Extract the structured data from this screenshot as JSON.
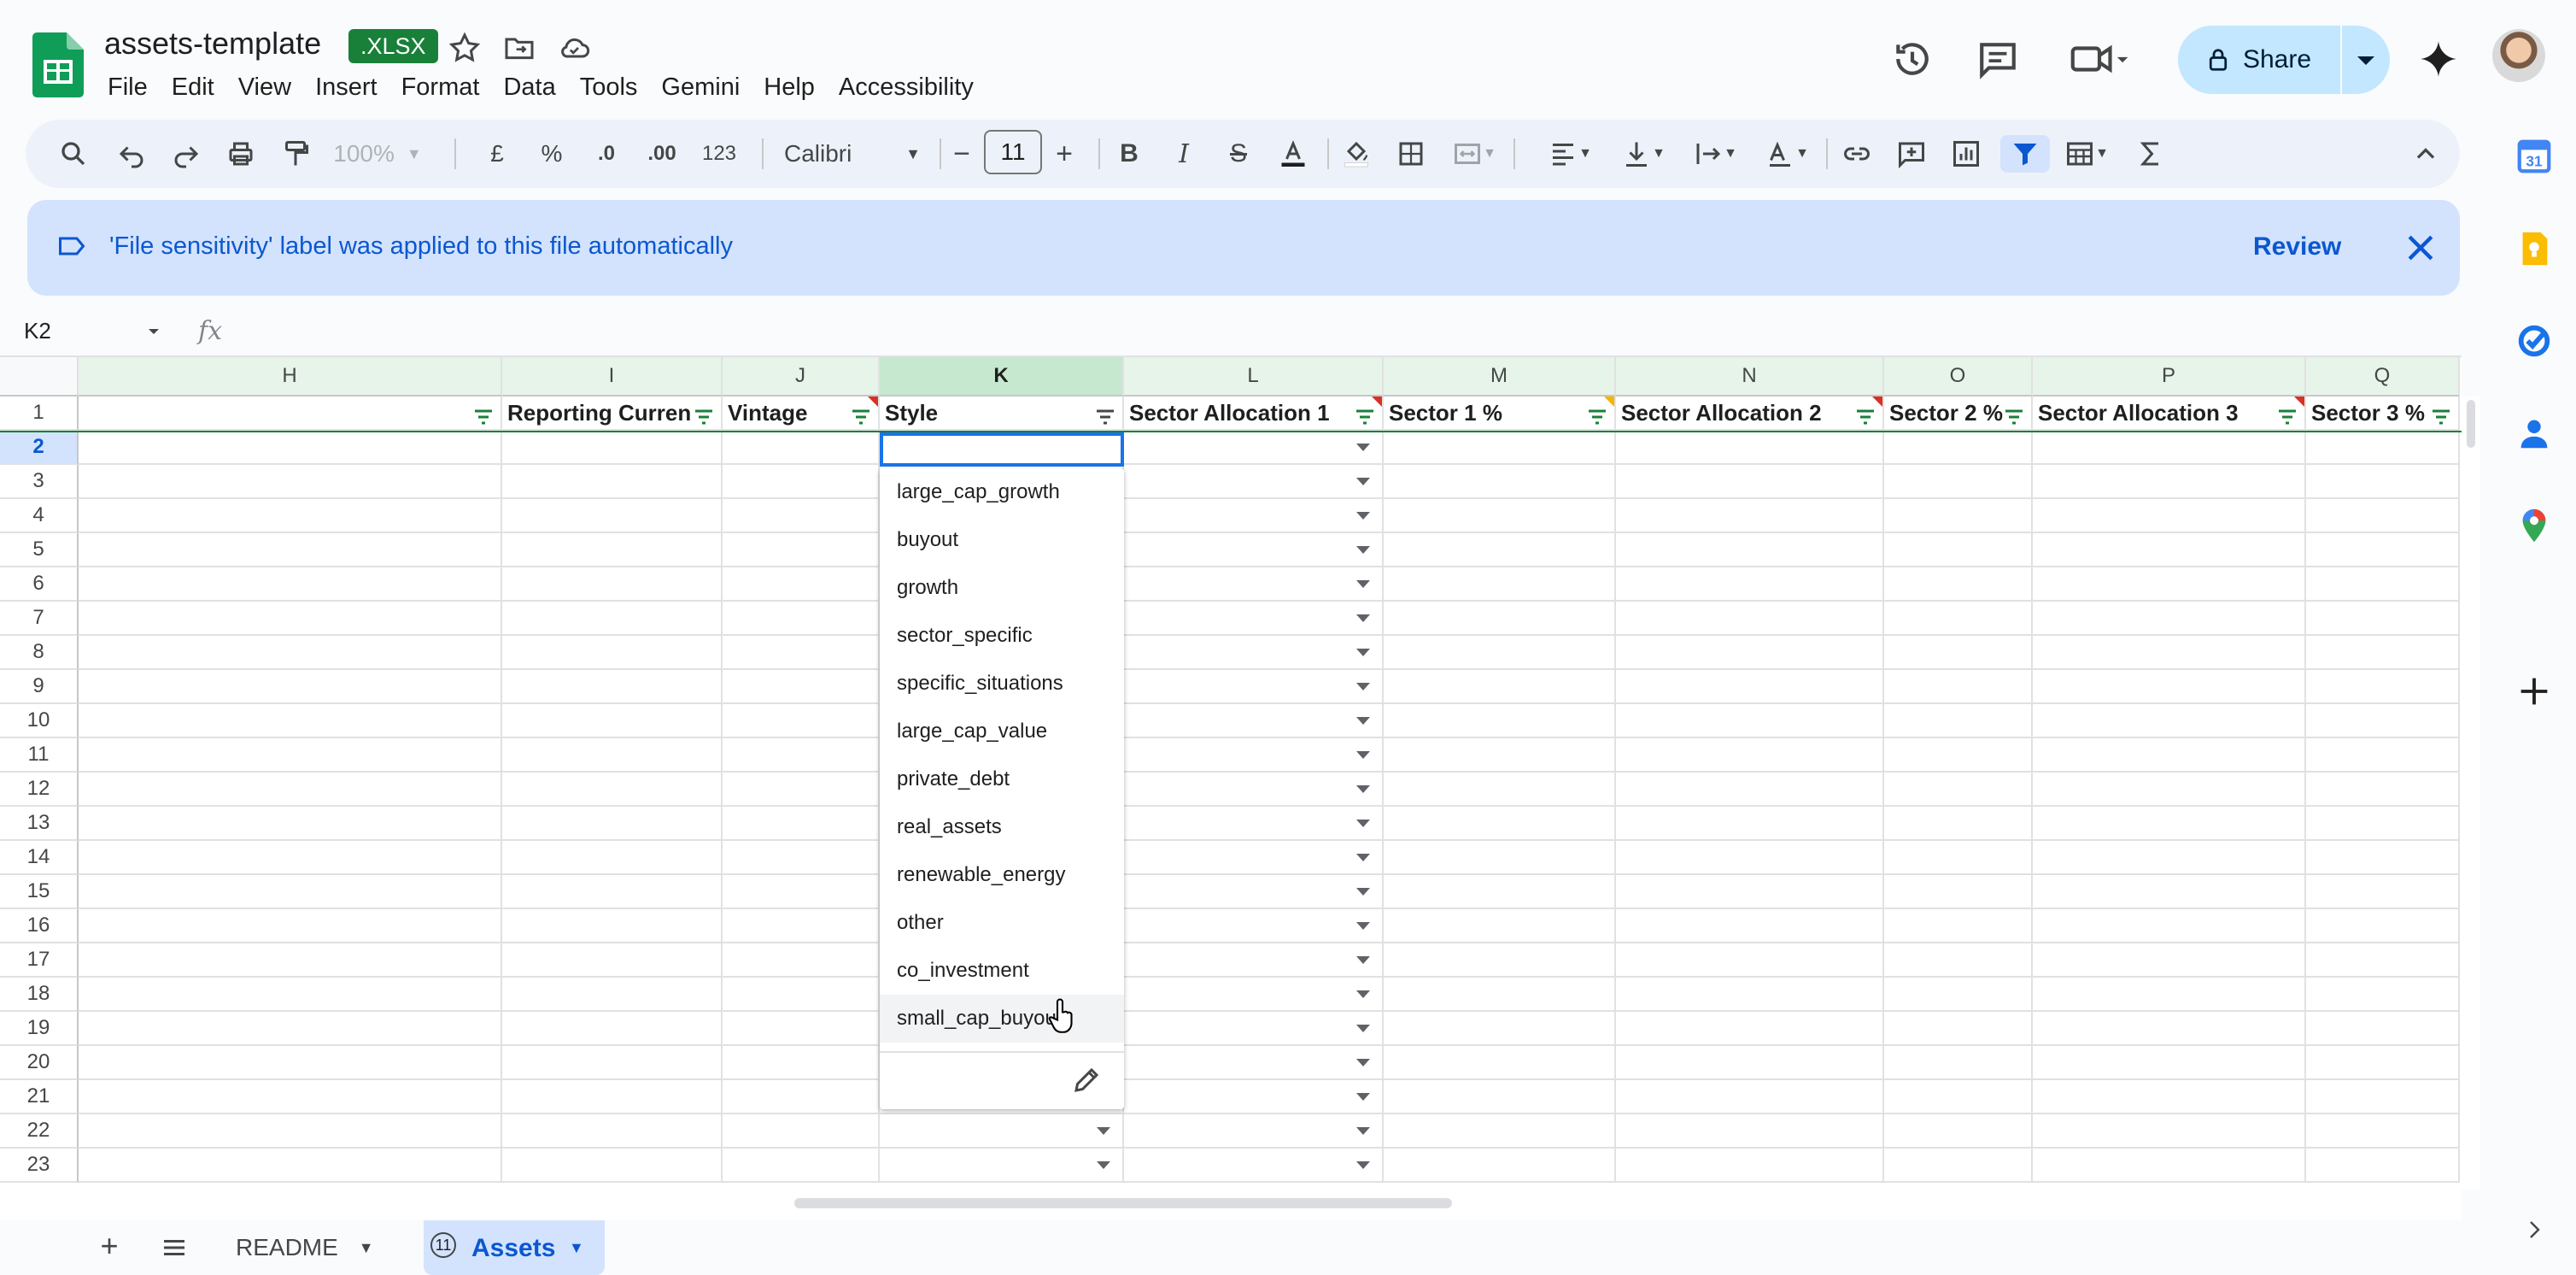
{
  "title_bar": {
    "doc_title": "assets-template",
    "badge": ".XLSX",
    "menu": [
      "File",
      "Edit",
      "View",
      "Insert",
      "Format",
      "Data",
      "Tools",
      "Gemini",
      "Help",
      "Accessibility"
    ],
    "share_label": "Share"
  },
  "toolbar": {
    "zoom": "100%",
    "currency": "£",
    "percent": "%",
    "dec_decrease": ".0",
    "dec_increase": ".00",
    "number_format": "123",
    "font": "Calibri",
    "font_size": "11"
  },
  "banner": {
    "text": "'File sensitivity' label was applied to this file automatically",
    "review_label": "Review"
  },
  "formula_bar": {
    "name_box": "K2",
    "fx": "fx"
  },
  "sheet": {
    "columns": [
      "H",
      "I",
      "J",
      "K",
      "L",
      "M",
      "N",
      "O",
      "P",
      "Q"
    ],
    "headers": [
      "",
      "Reporting Curren",
      "Vintage",
      "Style",
      "Sector Allocation 1",
      "Sector 1 %",
      "Sector Allocation 2",
      "Sector 2 %",
      "Sector Allocation 3",
      "Sector 3 %"
    ],
    "rows": [
      "1",
      "2",
      "3",
      "4",
      "5",
      "6",
      "7",
      "8",
      "9",
      "10",
      "11",
      "12",
      "13",
      "14",
      "15",
      "16",
      "17",
      "18",
      "19",
      "20",
      "21",
      "22",
      "23"
    ],
    "selected_cell": "K2"
  },
  "dropdown": {
    "options": [
      "large_cap_growth",
      "buyout",
      "growth",
      "sector_specific",
      "specific_situations",
      "large_cap_value",
      "private_debt",
      "real_assets",
      "renewable_energy",
      "other",
      "co_investment",
      "small_cap_buyout"
    ],
    "hovered": "small_cap_buyout"
  },
  "tabs": {
    "readme": "README",
    "assets": "Assets",
    "assets_badge": "11"
  },
  "colors": {
    "accent": "#0b57d0",
    "banner_bg": "#d3e3fd",
    "share_bg": "#c2e7ff",
    "sheets_green": "#0f9d58"
  },
  "icons": [
    "sheets-logo-icon",
    "star-icon",
    "move-folder-icon",
    "cloud-icon",
    "history-icon",
    "comment-icon",
    "meet-icon",
    "lock-icon",
    "gemini-icon",
    "search-icon",
    "undo-icon",
    "redo-icon",
    "print-icon",
    "paint-format-icon",
    "bold-icon",
    "italic-icon",
    "strikethrough-icon",
    "text-color-icon",
    "fill-color-icon",
    "borders-icon",
    "merge-icon",
    "align-icon",
    "valign-icon",
    "wrap-icon",
    "rotate-icon",
    "link-icon",
    "comment-add-icon",
    "chart-icon",
    "filter-icon",
    "table-icon",
    "functions-icon",
    "collapse-icon",
    "label-icon",
    "close-icon",
    "calendar-icon",
    "keep-icon",
    "tasks-icon",
    "contacts-icon",
    "maps-icon",
    "add-icon",
    "edit-icon",
    "menu-icon"
  ]
}
